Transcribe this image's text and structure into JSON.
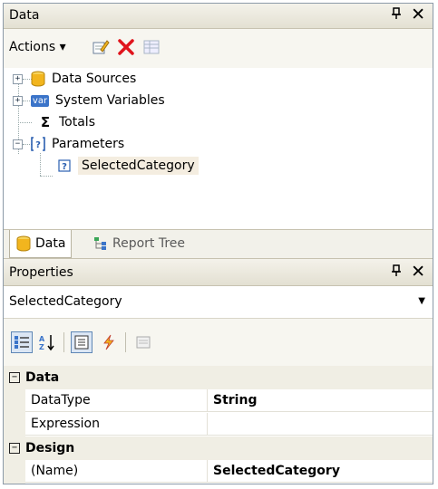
{
  "data_panel": {
    "title": "Data",
    "pin_glyph": "ᵖ",
    "close_glyph": "✕",
    "toolbar": {
      "actions_label": "Actions ▾",
      "icons": [
        "edit-icon",
        "delete-icon",
        "grid-icon"
      ]
    },
    "tree": {
      "nodes": [
        {
          "label": "Data Sources",
          "icon": "database-icon",
          "expander": "+"
        },
        {
          "label": "System Variables",
          "icon": "var-icon",
          "icon_text": "var",
          "expander": "+"
        },
        {
          "label": "Totals",
          "icon": "sigma-icon",
          "icon_text": "Σ"
        },
        {
          "label": "Parameters",
          "icon": "parameters-icon",
          "expander": "−"
        },
        {
          "label": "SelectedCategory",
          "icon": "parameter-icon",
          "selected": true
        }
      ]
    },
    "tabs": [
      {
        "label": "Data",
        "icon": "database-icon",
        "active": true
      },
      {
        "label": "Report Tree",
        "icon": "report-tree-icon",
        "active": false
      }
    ]
  },
  "properties_panel": {
    "title": "Properties",
    "pin_glyph": "ᵖ",
    "close_glyph": "✕",
    "object_selector": {
      "value": "SelectedCategory",
      "arrow": "▼"
    },
    "toolbar_icons": [
      "categorized-icon",
      "alphabetical-icon",
      "properties-icon",
      "events-icon",
      "property-pages-icon"
    ],
    "grid": [
      {
        "type": "category",
        "name": "Data",
        "expander": "−"
      },
      {
        "type": "property",
        "name": "DataType",
        "value": "String"
      },
      {
        "type": "property",
        "name": "Expression",
        "value": ""
      },
      {
        "type": "category",
        "name": "Design",
        "expander": "−"
      },
      {
        "type": "property",
        "name": "(Name)",
        "value": "SelectedCategory"
      }
    ]
  },
  "colors": {
    "title_bar": "#e3e0d2",
    "selection": "#f4ede0",
    "delete_red": "#e0141c",
    "database_gold": "#f2b51e"
  }
}
